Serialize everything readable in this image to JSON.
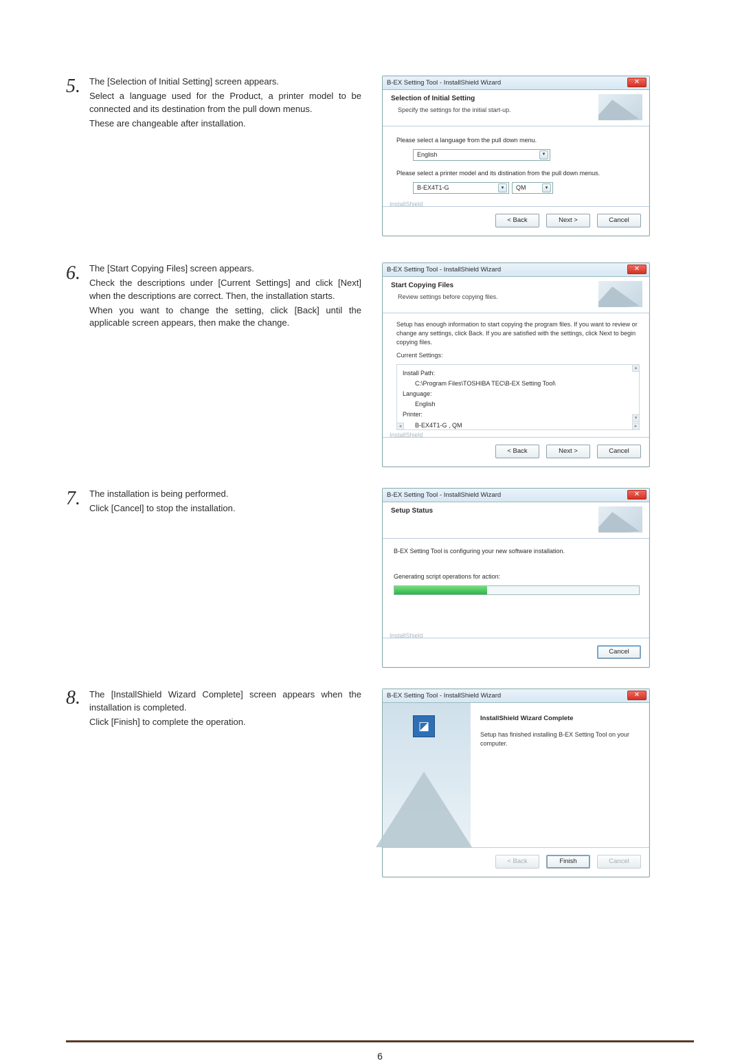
{
  "page_number": "6",
  "steps": {
    "s5": {
      "num": "5.",
      "text": [
        "The [Selection of Initial Setting] screen appears.",
        "Select a language used for the Product, a printer model to be connected and its destination from the pull down menus.",
        "These are changeable after installation."
      ]
    },
    "s6": {
      "num": "6.",
      "text": [
        "The [Start Copying Files] screen appears.",
        "Check the descriptions under [Current Settings] and click [Next] when the descriptions are correct.  Then, the installation starts.",
        "When you want to change the setting, click [Back] until the applicable screen appears, then make the change."
      ]
    },
    "s7": {
      "num": "7.",
      "text": [
        "The installation is being performed.",
        "Click [Cancel] to stop the installation."
      ]
    },
    "s8": {
      "num": "8.",
      "text": [
        "The [InstallShield Wizard Complete] screen appears when the installation is completed.",
        "Click [Finish] to complete the operation."
      ]
    }
  },
  "wizard_title": "B-EX Setting Tool - InstallShield Wizard",
  "brand": "InstallShield",
  "w5": {
    "title": "Selection of Initial Setting",
    "subtitle": "Specify the settings for the initial start-up.",
    "lang_label": "Please select a language from the pull down menu.",
    "lang_value": "English",
    "model_label": "Please select a printer model and its distination from the pull down menus.",
    "model_value": "B-EX4T1-G",
    "dest_value": "QM",
    "back": "< Back",
    "next": "Next >",
    "cancel": "Cancel"
  },
  "w6": {
    "title": "Start Copying Files",
    "subtitle": "Review settings before copying files.",
    "desc": "Setup has enough information to start copying the program files. If you want to review or change any settings, click Back. If you are satisfied with the settings, click Next to begin copying files.",
    "cs_label": "Current Settings:",
    "install_path_k": "Install Path:",
    "install_path_v": "C:\\Program Files\\TOSHIBA TEC\\B-EX Setting Tool\\",
    "lang_k": "Language:",
    "lang_v": "English",
    "printer_k": "Printer:",
    "printer_v": "B-EX4T1-G , QM",
    "back": "< Back",
    "next": "Next >",
    "cancel": "Cancel"
  },
  "w7": {
    "title": "Setup Status",
    "line1": "B-EX Setting Tool is configuring your new software installation.",
    "line2": "Generating script operations for action:",
    "cancel": "Cancel"
  },
  "w8": {
    "heading": "InstallShield Wizard Complete",
    "body": "Setup has finished installing B-EX Setting Tool on your computer.",
    "back": "< Back",
    "finish": "Finish",
    "cancel": "Cancel"
  }
}
